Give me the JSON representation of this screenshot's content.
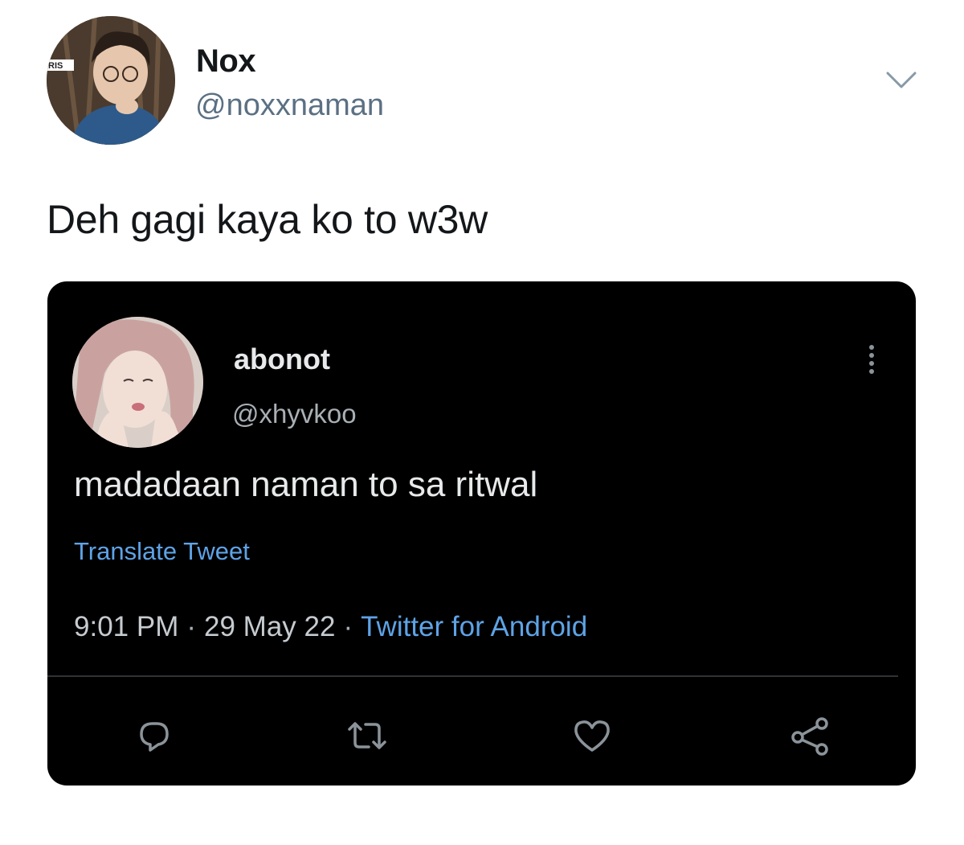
{
  "outer_tweet": {
    "name": "Nox",
    "handle": "@noxxnaman",
    "text": "Deh gagi kaya ko to w3w",
    "avatar_overlay_text": "RIS",
    "menu_icon": "chevron-down-icon"
  },
  "embedded_tweet": {
    "name": "abonot",
    "handle": "@xhyvkoo",
    "text": "madadaan naman to sa ritwal",
    "translate_label": "Translate Tweet",
    "time": "9:01 PM",
    "date": "29 May 22",
    "source": "Twitter for Android",
    "separator": "·",
    "actions": [
      "reply-icon",
      "retweet-icon",
      "like-icon",
      "share-icon"
    ],
    "more_icon": "more-vertical-icon"
  },
  "colors": {
    "link_blue": "#5ea3e6",
    "card_background": "#000000",
    "handle_gray": "#5b7083"
  }
}
